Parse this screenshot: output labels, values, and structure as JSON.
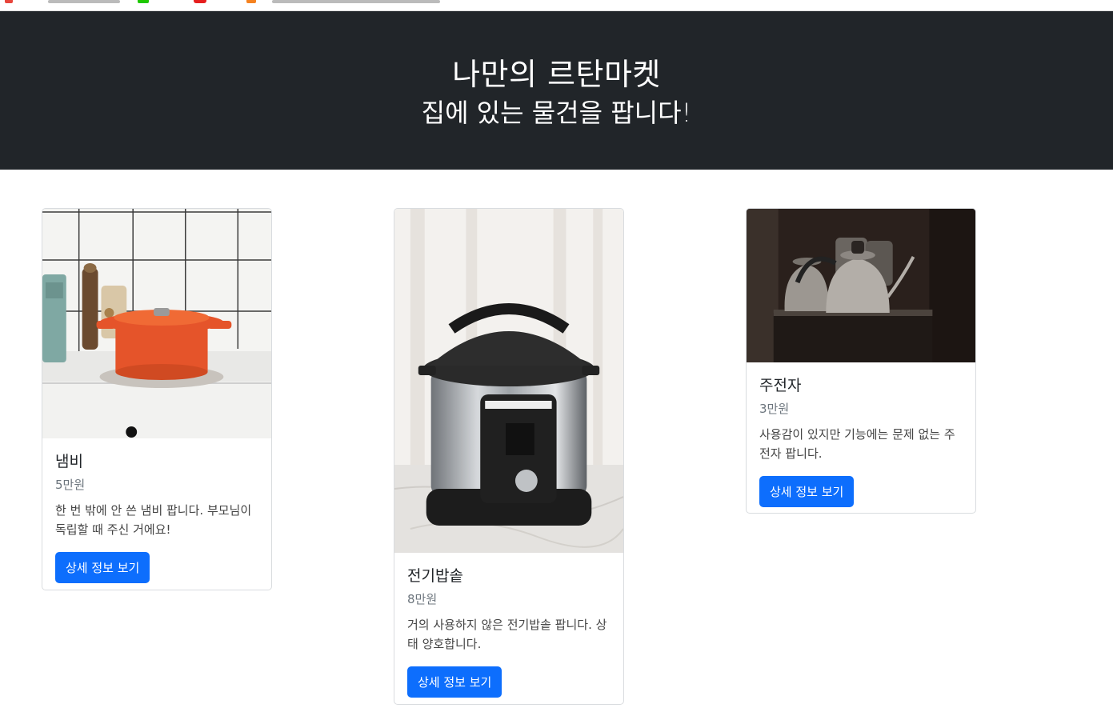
{
  "header": {
    "title": "나만의 르탄마켓",
    "subtitle": "집에 있는 물건을 팝니다!"
  },
  "products": [
    {
      "name": "냄비",
      "price": "5만원",
      "description": "한 번 밖에 안 쓴 냄비 팝니다. 부모님이 독립할 때 주신 거에요!",
      "button_label": "상세 정보 보기",
      "image": "orange-pot-photo"
    },
    {
      "name": "전기밥솥",
      "price": "8만원",
      "description": "거의 사용하지 않은 전기밥솥 팝니다. 상태 양호합니다.",
      "button_label": "상세 정보 보기",
      "image": "instant-pot-photo"
    },
    {
      "name": "주전자",
      "price": "3만원",
      "description": "사용감이 있지만 기능에는 문제 없는 주전자 팝니다.",
      "button_label": "상세 정보 보기",
      "image": "kettles-photo"
    }
  ],
  "colors": {
    "header_bg": "#212529",
    "button_bg": "#0d6efd",
    "muted_text": "#6c757d"
  }
}
